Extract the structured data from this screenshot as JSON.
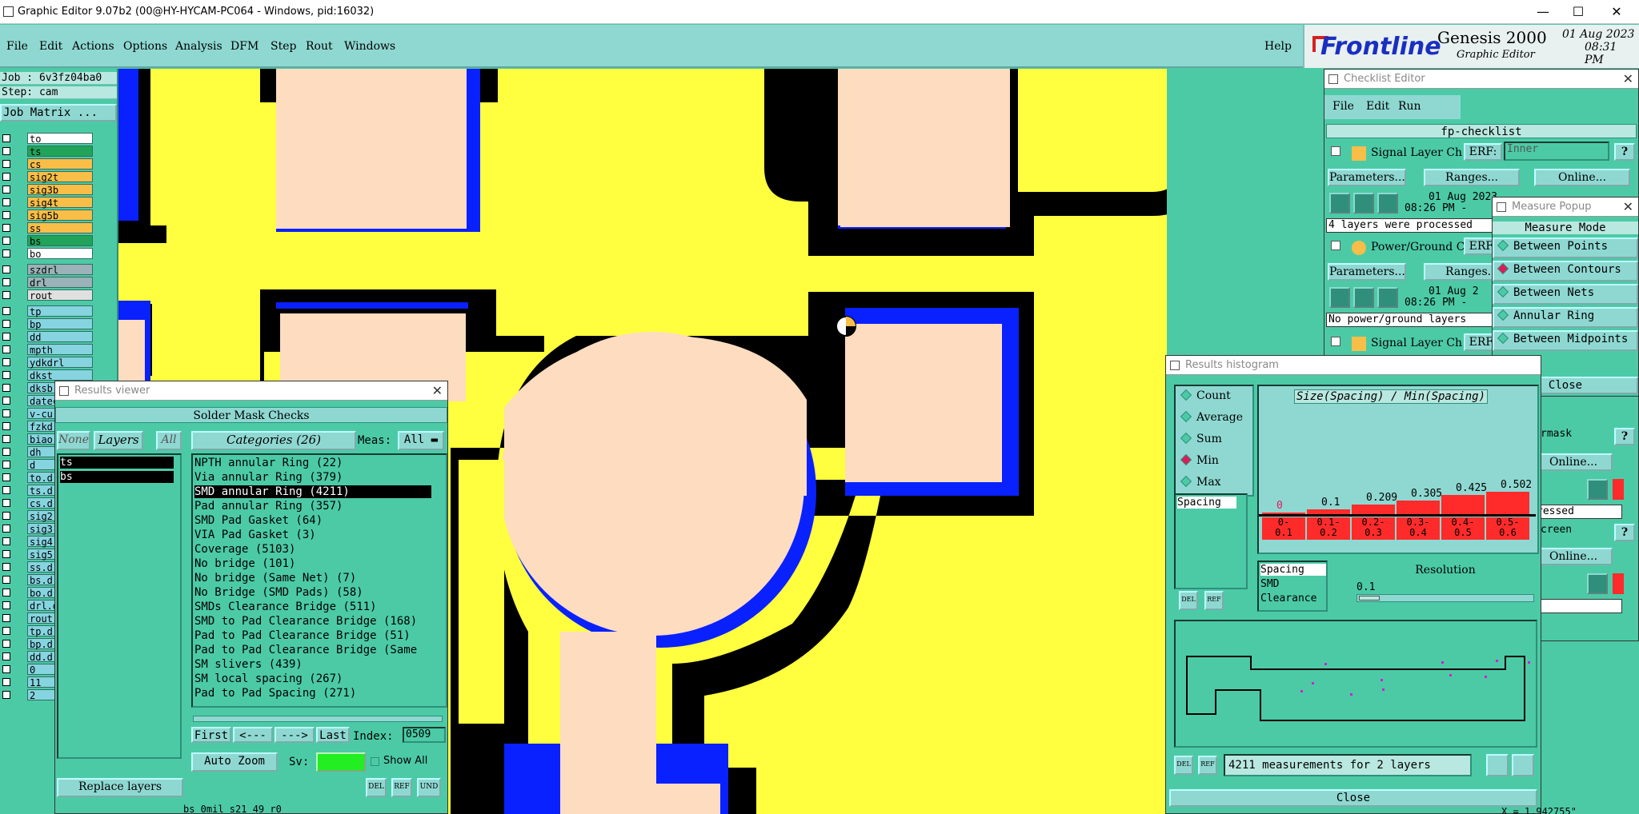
{
  "titlebar": {
    "title": "Graphic Editor 9.07b2 (00@HY-HYCAM-PC064 - Windows, pid:16032)",
    "min": "—",
    "max": "☐",
    "close": "✕"
  },
  "menu": {
    "items": [
      "File",
      "Edit",
      "Actions",
      "Options",
      "Analysis",
      "DFM",
      "Step",
      "Rout",
      "Windows"
    ],
    "help": "Help",
    "brand": "Frontline",
    "product": "Genesis 2000",
    "subtitle": "Graphic Editor",
    "date": "01 Aug 2023",
    "time": "08:31 PM"
  },
  "left": {
    "job": "Job : 6v3fz04ba0",
    "step": "Step: cam",
    "matrix_btn": "Job Matrix ...",
    "layers": [
      {
        "name": "to",
        "color": "#ffffff"
      },
      {
        "name": "ts",
        "color": "#21a35a"
      },
      {
        "name": "cs",
        "color": "#f8be48"
      },
      {
        "name": "sig2t",
        "color": "#f8be48"
      },
      {
        "name": "sig3b",
        "color": "#f8be48"
      },
      {
        "name": "sig4t",
        "color": "#f8be48"
      },
      {
        "name": "sig5b",
        "color": "#f8be48"
      },
      {
        "name": "ss",
        "color": "#f8be48"
      },
      {
        "name": "bs",
        "color": "#21a35a"
      },
      {
        "name": "bo",
        "color": "#ffffff"
      },
      {
        "name": "szdrl",
        "color": "#9ab2b8"
      },
      {
        "name": "drl",
        "color": "#9ab2b8"
      },
      {
        "name": "rout",
        "color": "#e0e0e0"
      },
      {
        "name": "tp",
        "color": "#86d4e0"
      },
      {
        "name": "bp",
        "color": "#86d4e0"
      },
      {
        "name": "dd",
        "color": "#86d4e0"
      },
      {
        "name": "mpth",
        "color": "#86d4e0"
      },
      {
        "name": "ydkdrl",
        "color": "#86d4e0"
      },
      {
        "name": "dkst",
        "color": "#86d4e0"
      },
      {
        "name": "dksb",
        "color": "#86d4e0"
      },
      {
        "name": "datec",
        "color": "#86d4e0"
      },
      {
        "name": "v-cu",
        "color": "#86d4e0"
      },
      {
        "name": "fzkd",
        "color": "#86d4e0"
      },
      {
        "name": "biao",
        "color": "#86d4e0"
      },
      {
        "name": "dh",
        "color": "#86d4e0"
      },
      {
        "name": "d",
        "color": "#86d4e0"
      },
      {
        "name": "to.d",
        "color": "#86d4e0"
      },
      {
        "name": "ts.d",
        "color": "#86d4e0"
      },
      {
        "name": "cs.d",
        "color": "#86d4e0"
      },
      {
        "name": "sig2",
        "color": "#86d4e0"
      },
      {
        "name": "sig3",
        "color": "#86d4e0"
      },
      {
        "name": "sig4",
        "color": "#86d4e0"
      },
      {
        "name": "sig5",
        "color": "#86d4e0"
      },
      {
        "name": "ss.d",
        "color": "#86d4e0"
      },
      {
        "name": "bs.d",
        "color": "#86d4e0"
      },
      {
        "name": "bo.d",
        "color": "#86d4e0"
      },
      {
        "name": "drl.d",
        "color": "#86d4e0"
      },
      {
        "name": "rout",
        "color": "#86d4e0"
      },
      {
        "name": "tp.d",
        "color": "#86d4e0"
      },
      {
        "name": "bp.d",
        "color": "#86d4e0"
      },
      {
        "name": "dd.d",
        "color": "#86d4e0"
      },
      {
        "name": "0",
        "color": "#86d4e0"
      },
      {
        "name": "11",
        "color": "#86d4e0"
      },
      {
        "name": "2",
        "color": "#86d4e0"
      }
    ]
  },
  "results_viewer": {
    "title": "Results viewer",
    "heading": "Solder Mask Checks",
    "none": "None",
    "layers": "Layers",
    "all": "All",
    "categories": "Categories (26)",
    "meas_label": "Meas:",
    "meas_value": "All",
    "layer_list": [
      "ts",
      "bs"
    ],
    "category_list": [
      "NPTH annular Ring (22)",
      "Via annular Ring (379)",
      "SMD annular Ring (4211)",
      "Pad annular Ring (357)",
      "SMD Pad Gasket (64)",
      "VIA Pad Gasket (3)",
      "Coverage (5103)",
      "No bridge (101)",
      "No bridge (Same Net) (7)",
      "No Bridge (SMD Pads) (58)",
      "SMDs Clearance Bridge (511)",
      "SMD to Pad Clearance Bridge (168)",
      "Pad to Pad Clearance Bridge (51)",
      "Pad to Pad Clearance Bridge (Same",
      "SM slivers (439)",
      "SM local spacing (267)",
      "Pad to Pad Spacing (271)"
    ],
    "first": "First",
    "prev": "<---",
    "next": "--->",
    "last": "Last",
    "index_label": "Index:",
    "index_value": "0509",
    "auto_zoom": "Auto Zoom",
    "sv_label": "Sv:",
    "show_all": "Show All",
    "replace_layers": "Replace layers",
    "status": "bs 0mil s21 49 r0"
  },
  "checklist": {
    "title": "Checklist Editor",
    "menu": [
      "File",
      "Edit",
      "Run"
    ],
    "name": "fp-checklist",
    "items": [
      {
        "label": "Signal Layer Ch",
        "erf": "ERF:",
        "erf_value": "Inner",
        "params": "Parameters...",
        "ranges": "Ranges...",
        "online": "Online...",
        "date": "01 Aug 2023",
        "time": "08:26 PM - ",
        "msg": "4 layers were processed"
      },
      {
        "label": "Power/Ground C",
        "erf": "ERF:",
        "erf_value": "",
        "params": "Parameters...",
        "ranges": "Ranges...",
        "online": "",
        "date": "01 Aug 2",
        "time": "08:26 PM -",
        "msg": "No power/ground layers"
      },
      {
        "label": "Signal Layer Ch",
        "erf": "ERF:"
      }
    ],
    "right_frag": [
      "rmask",
      "Online...",
      "ressed",
      "creen",
      "Online..."
    ]
  },
  "measure": {
    "title": "Measure Popup",
    "mode": "Measure Mode",
    "options": [
      "Between Points",
      "Between Contours",
      "Between Nets",
      "Annular Ring",
      "Between Midpoints"
    ],
    "selected": 1,
    "close": "Close"
  },
  "histogram": {
    "title": "Results histogram",
    "radios": [
      "Count",
      "Average",
      "Sum",
      "Min",
      "Max"
    ],
    "selected": 3,
    "chart_title": "Size(Spacing) / Min(Spacing)",
    "bar_values": [
      "0",
      "0.1",
      "0.209",
      "0.305",
      "0.425",
      "0.502"
    ],
    "bar_levels": [
      0.0,
      0.2,
      0.42,
      0.61,
      0.85,
      1.0
    ],
    "ranges": [
      [
        "0-",
        "0.1"
      ],
      [
        "0.1-",
        "0.2"
      ],
      [
        "0.2-",
        "0.3"
      ],
      [
        "0.3-",
        "0.4"
      ],
      [
        "0.4-",
        "0.5"
      ],
      [
        "0.5-",
        "0.6"
      ]
    ],
    "left_list": [
      "Spacing"
    ],
    "type_list": [
      "Spacing",
      "SMD",
      "Clearance"
    ],
    "resolution_label": "Resolution",
    "resolution_value": "0.1",
    "status": "4211 measurements for 2 layers",
    "close": "Close",
    "del": "DEL",
    "ref": "REF"
  },
  "coords": "X = 1.942755\"",
  "colors": {
    "teal": "#4ccaa6",
    "light_teal": "#8fd8d2",
    "yellow": "#ffff40",
    "blue": "#0a21ff",
    "pad": "#fddcc0"
  }
}
